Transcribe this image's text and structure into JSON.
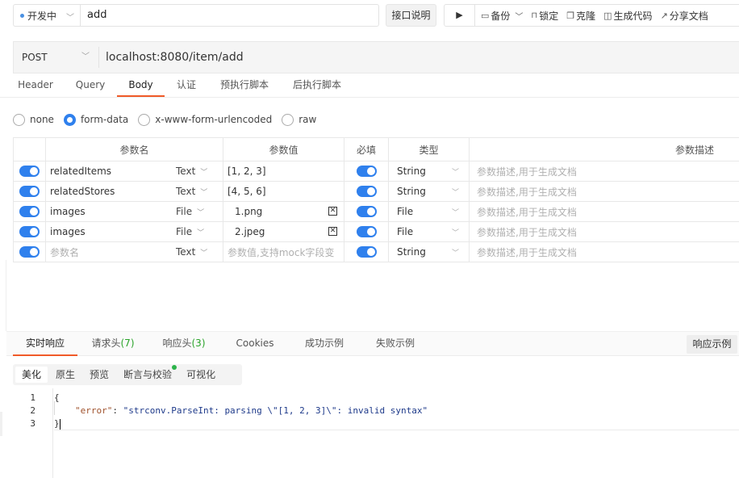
{
  "toolbar": {
    "env": "开发中",
    "name_value": "add",
    "doc_button": "接口说明",
    "actions": [
      {
        "icon": "backup-icon",
        "glyph": "▭",
        "label": "备份",
        "chev": "﹀"
      },
      {
        "icon": "lock-icon",
        "glyph": "🔒",
        "label": "锁定"
      },
      {
        "icon": "clone-icon",
        "glyph": "❐",
        "label": "克隆"
      },
      {
        "icon": "code-icon",
        "glyph": "◫",
        "label": "生成代码"
      },
      {
        "icon": "share-icon",
        "glyph": "↗",
        "label": "分享文档"
      }
    ]
  },
  "url_bar": {
    "method": "POST",
    "url": "localhost:8080/item/add"
  },
  "request_tabs": [
    "Header",
    "Query",
    "Body",
    "认证",
    "预执行脚本",
    "后执行脚本"
  ],
  "body_types": [
    "none",
    "form-data",
    "x-www-form-urlencoded",
    "raw"
  ],
  "params_table": {
    "headers": [
      "参数名",
      "参数值",
      "必填",
      "类型",
      "参数描述"
    ],
    "rows": [
      {
        "name": "relatedItems",
        "ptype": "Text",
        "value": "[1, 2, 3]",
        "type": "String",
        "desc": "参数描述,用于生成文档"
      },
      {
        "name": "relatedStores",
        "ptype": "Text",
        "value": "[4, 5, 6]",
        "type": "String",
        "desc": "参数描述,用于生成文档"
      },
      {
        "name": "images",
        "ptype": "File",
        "value": "1.png",
        "type": "File",
        "desc": "参数描述,用于生成文档"
      },
      {
        "name": "images",
        "ptype": "File",
        "value": "2.jpeg",
        "type": "File",
        "desc": "参数描述,用于生成文档"
      },
      {
        "name": "参数名",
        "ptype": "Text",
        "value": "参数值,支持mock字段变",
        "type": "String",
        "desc": "参数描述,用于生成文档"
      }
    ]
  },
  "response_tabs": {
    "realtime": "实时响应",
    "req_headers": "请求头",
    "req_headers_count": "(7)",
    "resp_headers": "响应头",
    "resp_headers_count": "(3)",
    "cookies": "Cookies",
    "success": "成功示例",
    "failure": "失败示例",
    "example_button": "响应示例"
  },
  "view_tabs": [
    "美化",
    "原生",
    "预览",
    "断言与校验",
    "可视化"
  ],
  "response_body": {
    "line1": "{",
    "key": "\"error\"",
    "colon": ": ",
    "value": "\"strconv.ParseInt: parsing \\\"[1, 2, 3]\\\": invalid syntax\"",
    "line3": "}",
    "line_numbers": [
      "1",
      "2",
      "3"
    ]
  },
  "colors": {
    "accent": "#f05a28",
    "toggle": "#2f80ed",
    "count": "#29a329"
  }
}
